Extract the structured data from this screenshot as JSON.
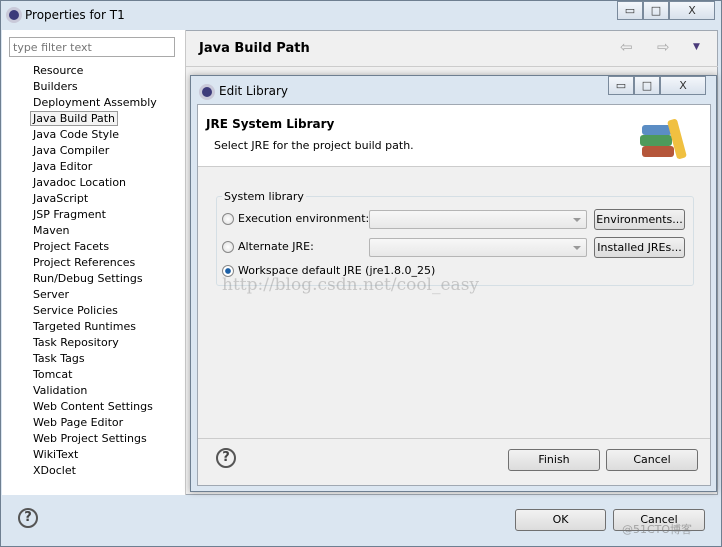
{
  "window": {
    "title": "Properties for T1",
    "minimize": "▭",
    "maximize": "□",
    "close": "X"
  },
  "filter": {
    "placeholder": "type filter text"
  },
  "tree": [
    {
      "label": "Resource",
      "expandable": true
    },
    {
      "label": "Builders",
      "expandable": false
    },
    {
      "label": "Deployment Assembly",
      "expandable": false
    },
    {
      "label": "Java Build Path",
      "expandable": false,
      "selected": true
    },
    {
      "label": "Java Code Style",
      "expandable": true
    },
    {
      "label": "Java Compiler",
      "expandable": true
    },
    {
      "label": "Java Editor",
      "expandable": true
    },
    {
      "label": "Javadoc Location",
      "expandable": false
    },
    {
      "label": "JavaScript",
      "expandable": true
    },
    {
      "label": "JSP Fragment",
      "expandable": false
    },
    {
      "label": "Maven",
      "expandable": true
    },
    {
      "label": "Project Facets",
      "expandable": false
    },
    {
      "label": "Project References",
      "expandable": false
    },
    {
      "label": "Run/Debug Settings",
      "expandable": false
    },
    {
      "label": "Server",
      "expandable": false
    },
    {
      "label": "Service Policies",
      "expandable": false
    },
    {
      "label": "Targeted Runtimes",
      "expandable": false
    },
    {
      "label": "Task Repository",
      "expandable": true
    },
    {
      "label": "Task Tags",
      "expandable": false
    },
    {
      "label": "Tomcat",
      "expandable": false
    },
    {
      "label": "Validation",
      "expandable": true
    },
    {
      "label": "Web Content Settings",
      "expandable": false
    },
    {
      "label": "Web Page Editor",
      "expandable": false
    },
    {
      "label": "Web Project Settings",
      "expandable": false
    },
    {
      "label": "WikiText",
      "expandable": false
    },
    {
      "label": "XDoclet",
      "expandable": true
    }
  ],
  "page": {
    "title": "Java Build Path",
    "nav_back": "⇦",
    "nav_forward": "⇨",
    "menu": "▼"
  },
  "dialog": {
    "title": "Edit Library",
    "heading": "JRE System Library",
    "description": "Select JRE for the project build path.",
    "group_label": "System library",
    "options": [
      {
        "label": "Execution environment:",
        "selected": false,
        "button": "Environments..."
      },
      {
        "label": "Alternate JRE:",
        "selected": false,
        "button": "Installed JREs..."
      },
      {
        "label": "Workspace default JRE (jre1.8.0_25)",
        "selected": true
      }
    ],
    "finish": "Finish",
    "cancel": "Cancel",
    "help": "?"
  },
  "footer": {
    "ok": "OK",
    "cancel": "Cancel",
    "help": "?"
  },
  "watermark": "http://blog.csdn.net/cool_easy",
  "corner_watermark": "@51CTO博客"
}
